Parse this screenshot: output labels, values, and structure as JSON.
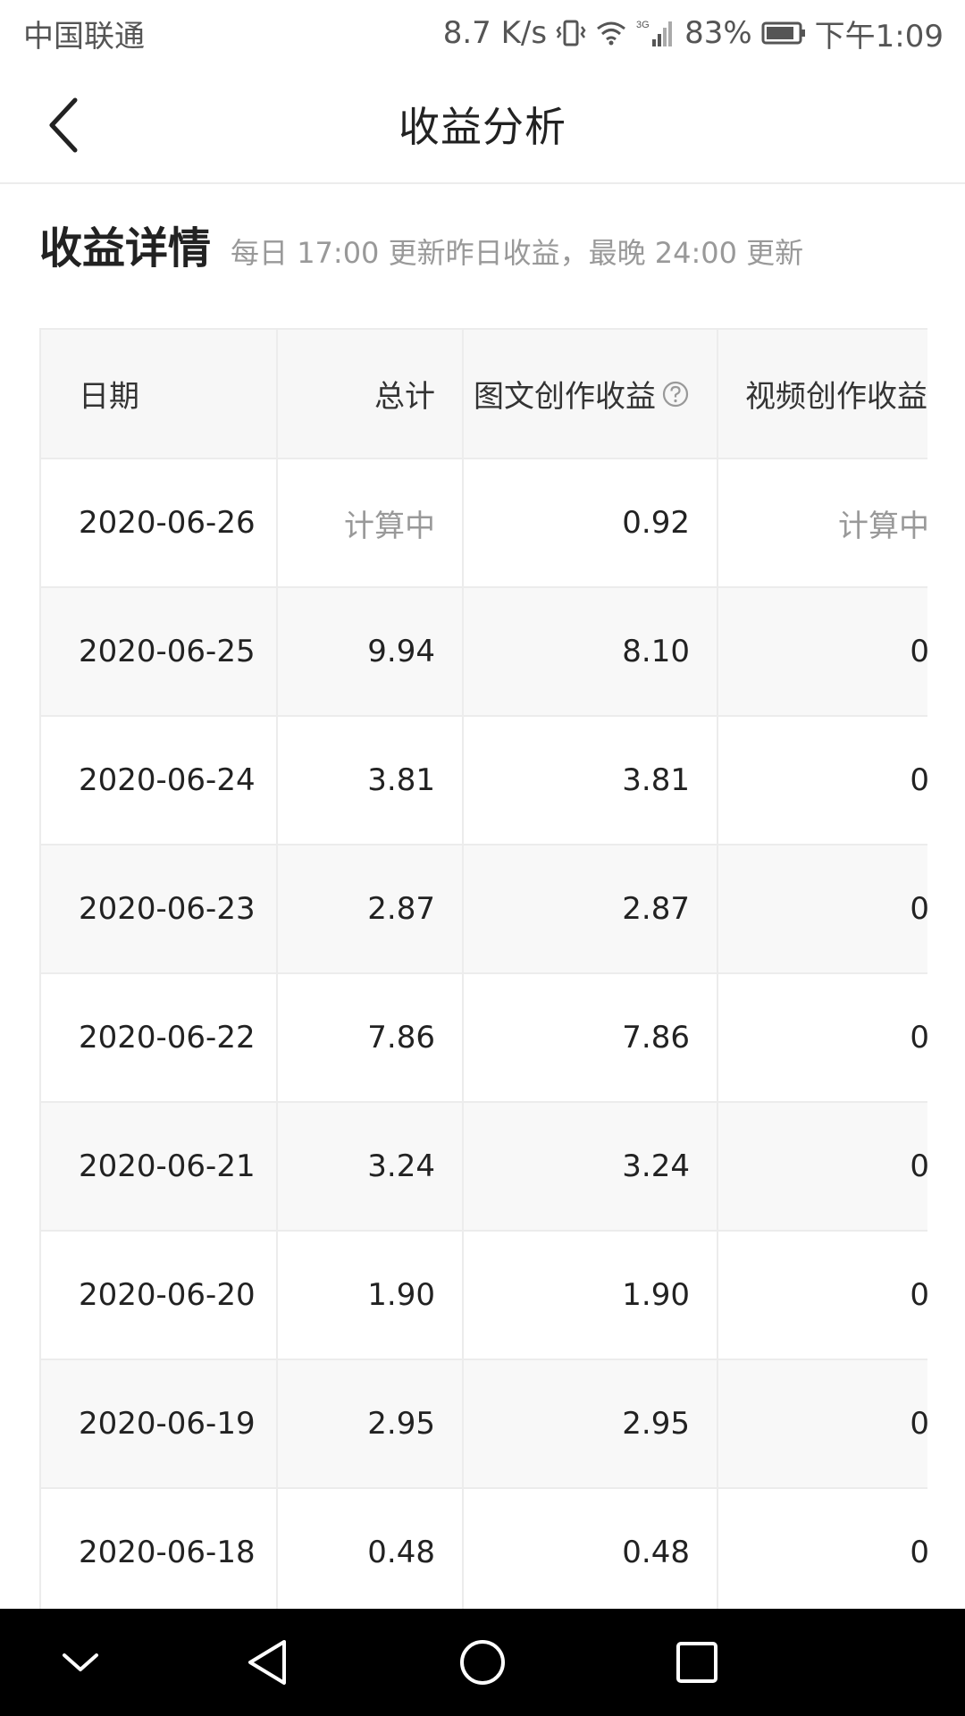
{
  "status_bar": {
    "carrier": "中国联通",
    "speed": "8.7 K/s",
    "network": "3G",
    "battery": "83%",
    "time": "下午1:09",
    "icons": [
      "vibrate-icon",
      "wifi-icon",
      "signal-icon",
      "battery-icon"
    ]
  },
  "header": {
    "title": "收益分析",
    "back_icon": "back-arrow-icon"
  },
  "section": {
    "title": "收益详情",
    "note": "每日 17:00 更新昨日收益，最晚 24:00 更新"
  },
  "table": {
    "columns": [
      "日期",
      "总计",
      "图文创作收益",
      "视频创作收益"
    ],
    "help_icon": "question-circle-icon",
    "rows": [
      {
        "date": "2020-06-26",
        "total": "计算中",
        "text_income": "0.92",
        "video_income": "计算中"
      },
      {
        "date": "2020-06-25",
        "total": "9.94",
        "text_income": "8.10",
        "video_income": "0"
      },
      {
        "date": "2020-06-24",
        "total": "3.81",
        "text_income": "3.81",
        "video_income": "0"
      },
      {
        "date": "2020-06-23",
        "total": "2.87",
        "text_income": "2.87",
        "video_income": "0"
      },
      {
        "date": "2020-06-22",
        "total": "7.86",
        "text_income": "7.86",
        "video_income": "0"
      },
      {
        "date": "2020-06-21",
        "total": "3.24",
        "text_income": "3.24",
        "video_income": "0"
      },
      {
        "date": "2020-06-20",
        "total": "1.90",
        "text_income": "1.90",
        "video_income": "0"
      },
      {
        "date": "2020-06-19",
        "total": "2.95",
        "text_income": "2.95",
        "video_income": "0"
      },
      {
        "date": "2020-06-18",
        "total": "0.48",
        "text_income": "0.48",
        "video_income": "0"
      }
    ]
  },
  "nav_bar": {
    "buttons": [
      "collapse-icon",
      "back-triangle-icon",
      "home-circle-icon",
      "recents-square-icon"
    ]
  },
  "colors": {
    "header_bg": "#f7f7f7",
    "alt_row_bg": "#f8f8f8",
    "border": "#ececec",
    "muted_text": "#999999",
    "nav_bg": "#000000"
  }
}
